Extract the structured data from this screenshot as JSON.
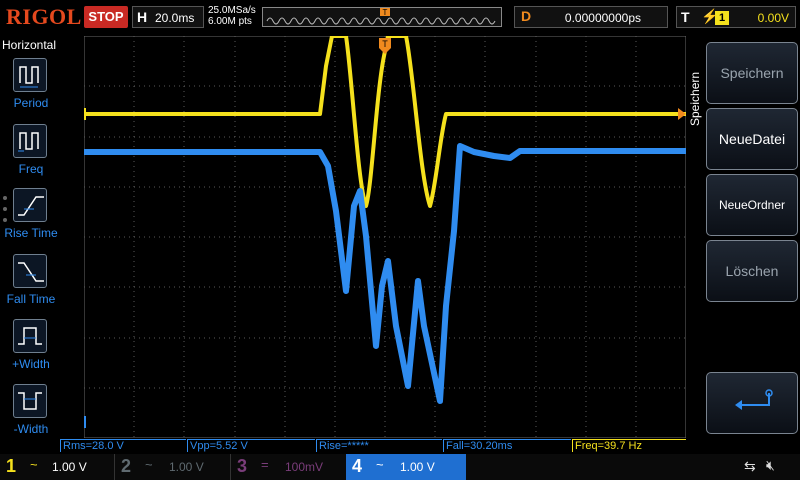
{
  "top": {
    "logo": "RIGOL",
    "run_state": "STOP",
    "timebase_letter": "H",
    "timebase": "20.0ms",
    "sample_rate": "25.0MSa/s",
    "memory_depth": "6.00M pts",
    "trigger_pos_marker": "T",
    "delay_letter": "D",
    "delay": "0.00000000ps",
    "trigger_letter": "T",
    "trigger_source": "1",
    "trigger_level": "0.00V"
  },
  "left_menu": {
    "title": "Horizontal",
    "items": [
      {
        "label": "Period",
        "icon": "period-icon"
      },
      {
        "label": "Freq",
        "icon": "freq-icon"
      },
      {
        "label": "Rise Time",
        "icon": "rise-time-icon"
      },
      {
        "label": "Fall Time",
        "icon": "fall-time-icon"
      },
      {
        "label": "+Width",
        "icon": "plus-width-icon"
      },
      {
        "label": "-Width",
        "icon": "minus-width-icon"
      }
    ]
  },
  "measurements": {
    "rms": "Rms=28.0 V",
    "vpp": "Vpp=5.52 V",
    "rise": "Rise=*****",
    "fall": "Fall=30.20ms",
    "freq": "Freq=39.7 Hz"
  },
  "channels": [
    {
      "num": "1",
      "coupling": "~",
      "scale": "1.00 V",
      "color": "#f5e11d"
    },
    {
      "num": "2",
      "coupling": "~",
      "scale": "1.00 V",
      "color": "#5f6a70"
    },
    {
      "num": "3",
      "coupling": "=",
      "scale": "100mV",
      "color": "#7a3d7a"
    },
    {
      "num": "4",
      "coupling": "~",
      "scale": "1.00 V",
      "color": "#ffffff"
    }
  ],
  "right_menu": {
    "title": "Speichern",
    "buttons": [
      {
        "label": "Speichern",
        "enabled": false
      },
      {
        "label": "NeueDatei",
        "enabled": true
      },
      {
        "label": "NeueOrdner",
        "enabled": true
      },
      {
        "label": "Löschen",
        "enabled": false
      },
      {
        "label": "",
        "icon": "return-icon",
        "enabled": true
      }
    ]
  },
  "colors": {
    "ch1": "#f5e11d",
    "ch4": "#2f8cf0",
    "grid": "#5a5a5a",
    "accent_orange": "#f08a1e",
    "stop_red": "#c92a24"
  },
  "traces": {
    "ch1_marker": "1",
    "ch4_marker": "4",
    "trigger_marker": "T"
  }
}
